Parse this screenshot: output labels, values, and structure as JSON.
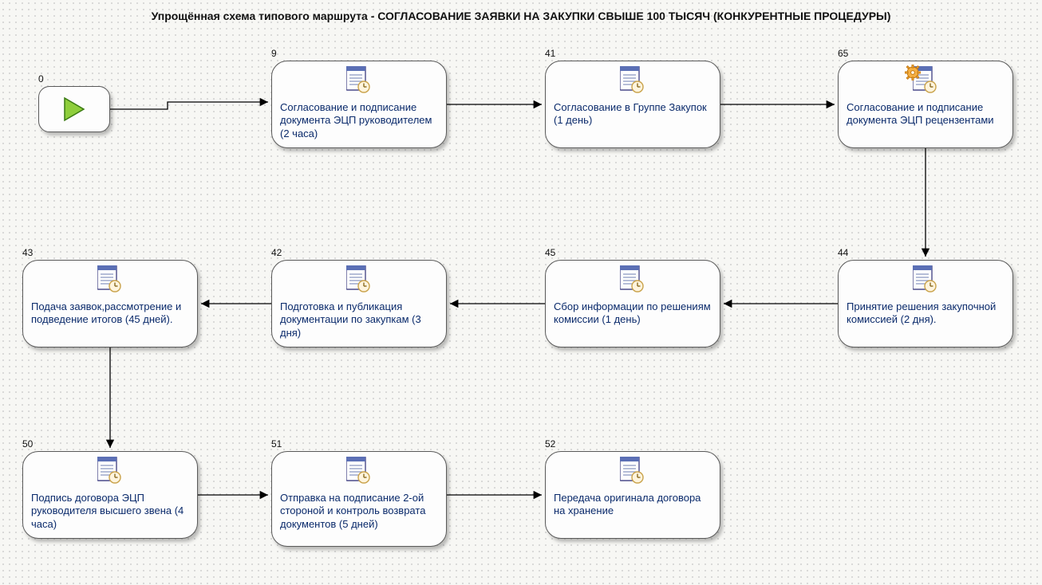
{
  "title": "Упрощённая схема типового маршрута - СОГЛАСОВАНИЕ ЗАЯВКИ НА ЗАКУПКИ СВЫШЕ 100 ТЫСЯЧ (КОНКУРЕНТНЫЕ ПРОЦЕДУРЫ)",
  "start": {
    "id": "0"
  },
  "nodes": {
    "n9": {
      "id": "9",
      "text": "Согласование и подписание документа ЭЦП руководителем (2 часа)"
    },
    "n41": {
      "id": "41",
      "text": "Согласование в Группе Закупок (1 день)"
    },
    "n65": {
      "id": "65",
      "text": "Согласование и подписание документа ЭЦП рецензентами"
    },
    "n44": {
      "id": "44",
      "text": "Принятие решения закупочной комиссией (2 дня)."
    },
    "n45": {
      "id": "45",
      "text": "Сбор информации по решениям комиссии (1 день)"
    },
    "n42": {
      "id": "42",
      "text": "Подготовка и публикация документации по закупкам (3 дня)"
    },
    "n43": {
      "id": "43",
      "text": "Подача заявок,рассмотрение и подведение итогов (45 дней)."
    },
    "n50": {
      "id": "50",
      "text": "Подпись договора ЭЦП руководителя высшего звена (4 часа)"
    },
    "n51": {
      "id": "51",
      "text": "Отправка на подписание 2-ой стороной и контроль возврата документов (5 дней)"
    },
    "n52": {
      "id": "52",
      "text": "Передача оригинала договора на хранение"
    }
  },
  "chart_data": {
    "type": "diagram",
    "title": "Упрощённая схема типового маршрута - СОГЛАСОВАНИЕ ЗАЯВКИ НА ЗАКУПКИ СВЫШЕ 100 ТЫСЯЧ (КОНКУРЕНТНЫЕ ПРОЦЕДУРЫ)",
    "nodes": [
      {
        "id": 0,
        "kind": "start"
      },
      {
        "id": 9,
        "kind": "task",
        "label": "Согласование и подписание документа ЭЦП руководителем (2 часа)"
      },
      {
        "id": 41,
        "kind": "task",
        "label": "Согласование в Группе Закупок (1 день)"
      },
      {
        "id": 65,
        "kind": "task",
        "label": "Согласование и подписание документа ЭЦП рецензентами",
        "has_gear": true
      },
      {
        "id": 44,
        "kind": "task",
        "label": "Принятие решения закупочной комиссией (2 дня)."
      },
      {
        "id": 45,
        "kind": "task",
        "label": "Сбор информации по решениям комиссии (1 день)"
      },
      {
        "id": 42,
        "kind": "task",
        "label": "Подготовка и публикация документации по закупкам (3 дня)"
      },
      {
        "id": 43,
        "kind": "task",
        "label": "Подача заявок,рассмотрение и подведение итогов (45 дней)."
      },
      {
        "id": 50,
        "kind": "task",
        "label": "Подпись договора ЭЦП руководителя высшего звена (4 часа)"
      },
      {
        "id": 51,
        "kind": "task",
        "label": "Отправка на подписание 2-ой стороной и контроль возврата документов (5 дней)"
      },
      {
        "id": 52,
        "kind": "task",
        "label": "Передача оригинала договора на хранение"
      }
    ],
    "edges": [
      [
        0,
        9
      ],
      [
        9,
        41
      ],
      [
        41,
        65
      ],
      [
        65,
        44
      ],
      [
        44,
        45
      ],
      [
        45,
        42
      ],
      [
        42,
        43
      ],
      [
        43,
        50
      ],
      [
        50,
        51
      ],
      [
        51,
        52
      ]
    ]
  }
}
